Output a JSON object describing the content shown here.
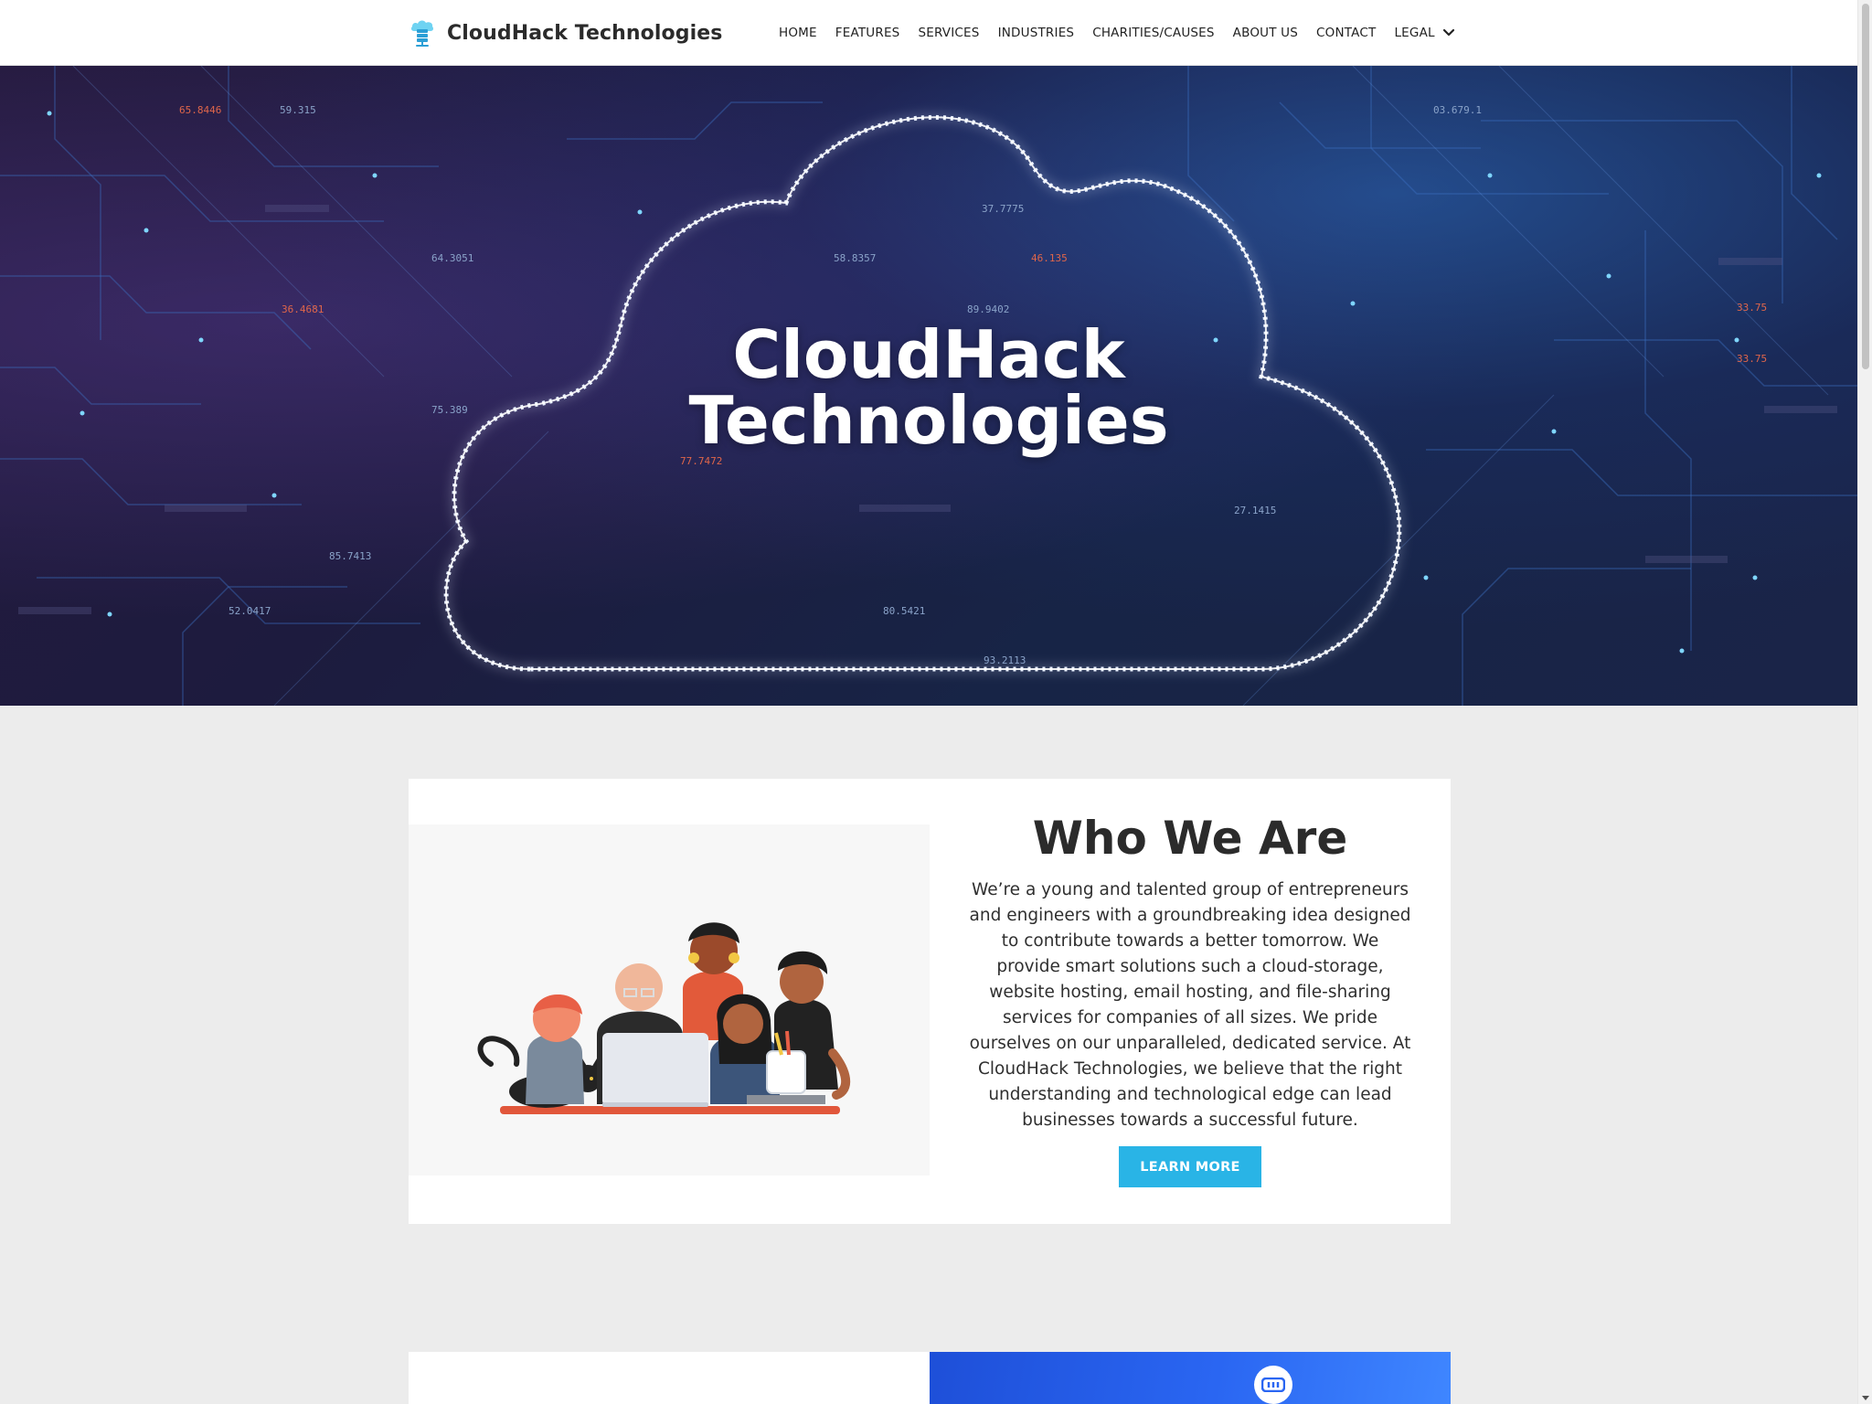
{
  "header": {
    "brand_name": "CloudHack Technologies",
    "logo_icon": "cloud-server-icon",
    "nav": [
      {
        "label": "HOME"
      },
      {
        "label": "FEATURES"
      },
      {
        "label": "SERVICES"
      },
      {
        "label": "INDUSTRIES"
      },
      {
        "label": "CHARITIES/CAUSES"
      },
      {
        "label": "ABOUT US"
      },
      {
        "label": "CONTACT"
      },
      {
        "label": "LEGAL",
        "icon": "chevron-down-icon"
      }
    ]
  },
  "hero": {
    "title_line1": "CloudHack",
    "title_line2": "Technologies",
    "background_numbers": [
      "65.8446",
      "59.315",
      "64.3051",
      "58.8357",
      "46.135",
      "37.7775",
      "36.4681",
      "89.9402",
      "75.389",
      "77.7472",
      "85.7413",
      "52.0417",
      "80.5421",
      "93.2113",
      "27.1415",
      "33.75",
      "33.75",
      "03.679.1"
    ]
  },
  "about": {
    "title": "Who We Are",
    "body": "We’re a young and talented group of entrepreneurs and engineers with a groundbreaking idea designed to contribute towards a better tomorrow. We provide smart solutions such a cloud-storage, website hosting, email hosting, and file-sharing services for companies of all sizes. We pride ourselves on our unparalleled, dedicated service. At CloudHack Technologies, we believe that the right understanding and technological edge can lead businesses towards a successful future.",
    "button_label": "LEARN MORE",
    "illustration": "team-around-laptop-illustration"
  },
  "next_section": {
    "icon": "server-icon"
  },
  "colors": {
    "accent": "#29b4e6",
    "header_bg": "#ffffff",
    "page_bg": "#ececec",
    "hero_bg": "#1d1b3e",
    "next_panel": "#2a66f2"
  }
}
